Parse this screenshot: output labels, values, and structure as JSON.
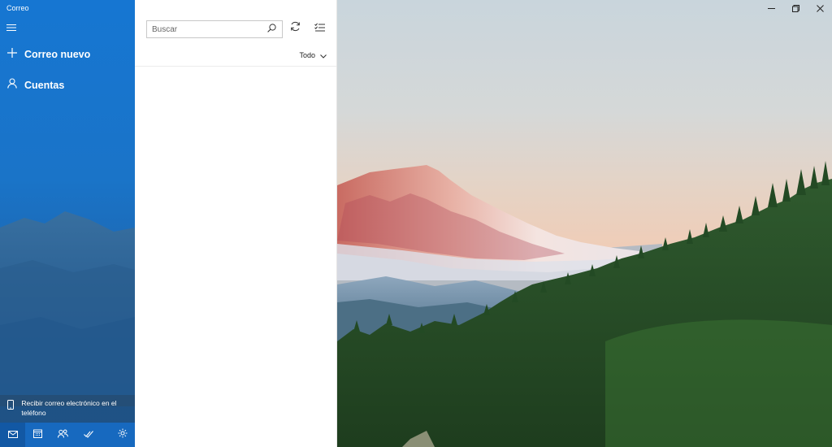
{
  "app": {
    "title": "Correo"
  },
  "nav": {
    "menu_icon": "hamburger-menu-icon",
    "new_mail_label": "Correo nuevo",
    "new_mail_icon": "plus-icon",
    "accounts_label": "Cuentas",
    "accounts_icon": "person-icon",
    "phone_promo_label": "Recibir correo electrónico en el teléfono",
    "phone_promo_icon": "phone-icon",
    "bottom_bar": [
      {
        "name": "mail-switch",
        "icon": "mail-icon",
        "active": true
      },
      {
        "name": "calendar-switch",
        "icon": "calendar-icon",
        "active": false
      },
      {
        "name": "people-switch",
        "icon": "people-icon",
        "active": false
      },
      {
        "name": "todo-switch",
        "icon": "double-check-icon",
        "active": false
      },
      {
        "name": "settings",
        "icon": "gear-icon",
        "active": false
      }
    ]
  },
  "list": {
    "search_placeholder": "Buscar",
    "search_icon": "search-icon",
    "sync_icon": "sync-icon",
    "select_icon": "checklist-icon",
    "filter_label": "Todo",
    "filter_icon": "chevron-down-icon"
  },
  "window_controls": [
    "minimize-icon",
    "restore-icon",
    "close-icon"
  ],
  "colors": {
    "nav_blue": "#1676d2",
    "bottom_bar": "#1769bf",
    "active_tab": "#1258a4"
  }
}
